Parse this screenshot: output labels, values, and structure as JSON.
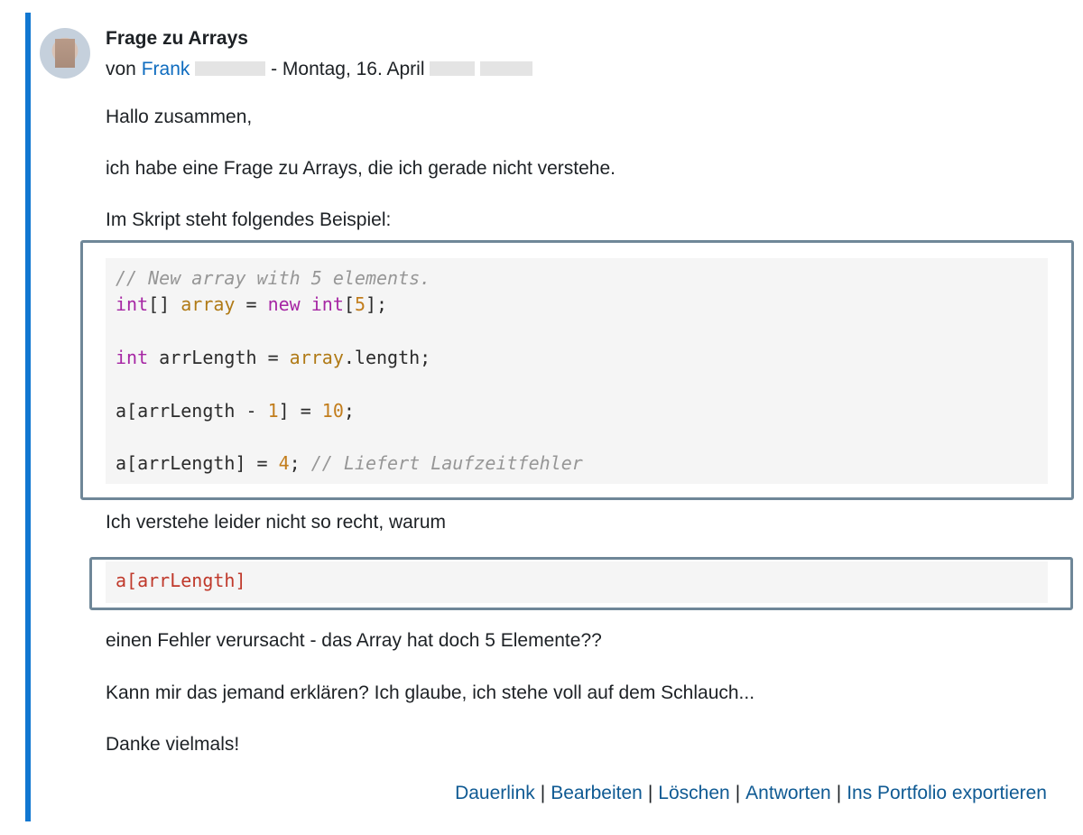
{
  "post": {
    "subject": "Frage zu Arrays",
    "by_prefix": "von",
    "author": "Frank",
    "date_sep": " - ",
    "date": "Montag, 16. April",
    "paragraphs": {
      "greeting": "Hallo zusammen,",
      "question": "ich habe eine Frage zu Arrays, die ich gerade nicht verstehe.",
      "script_intro": "Im Skript steht folgendes Beispiel:",
      "confusion": "Ich verstehe leider nicht so recht, warum",
      "error": "einen Fehler verursacht - das Array hat doch 5 Elemente??",
      "ask": "Kann mir das jemand erklären? Ich glaube, ich stehe voll auf dem Schlauch...",
      "thanks": "Danke vielmals!"
    },
    "code_block": {
      "line1_comment": "// New array with 5 elements.",
      "line2_kw": "int",
      "line2_brackets": "[] ",
      "line2_var": "array",
      "line2_eq": " = ",
      "line2_new": "new",
      "line2_sp": " ",
      "line2_int": "int",
      "line2_open": "[",
      "line2_num": "5",
      "line2_close": "];",
      "line3_kw": "int",
      "line3_mid": " arrLength = ",
      "line3_var": "array",
      "line3_end": ".length;",
      "line4_start": "a[arrLength - ",
      "line4_num1": "1",
      "line4_mid": "] = ",
      "line4_num2": "10",
      "line4_end": ";",
      "line5_start": "a[arrLength] = ",
      "line5_num": "4",
      "line5_semi": "; ",
      "line5_comment": "// Liefert Laufzeitfehler"
    },
    "inline_code": "a[arrLength]",
    "actions": {
      "permalink": "Dauerlink",
      "edit": "Bearbeiten",
      "delete": "Löschen",
      "reply": "Antworten",
      "export": "Ins Portfolio exportieren",
      "separator": "|"
    }
  },
  "colors": {
    "accent": "#1177d1",
    "link": "#0f6cbf",
    "frame": "#6f8798"
  }
}
